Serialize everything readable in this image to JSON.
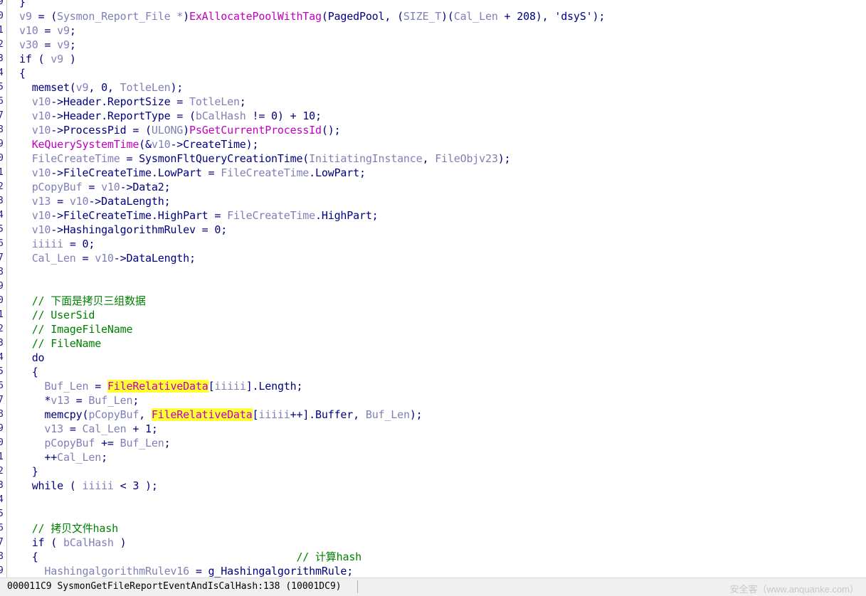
{
  "code_view": {
    "line_number_digits": [
      "9",
      "0",
      "1",
      "2",
      "3",
      "4",
      "5",
      "6",
      "7",
      "8",
      "9",
      "0",
      "1",
      "2",
      "3",
      "4",
      "5",
      "6",
      "7",
      "8",
      "9",
      "0",
      "1",
      "2",
      "3",
      "4",
      "5",
      "6",
      "7",
      "8",
      "9",
      "0",
      "1",
      "2",
      "3",
      "4",
      "5",
      "6",
      "7",
      "8",
      "9",
      "0"
    ],
    "lines": [
      [
        [
          "}",
          "kw"
        ]
      ],
      [
        [
          "v9",
          "var"
        ],
        [
          " = (",
          "kw"
        ],
        [
          "Sysmon_Report_File *",
          "var"
        ],
        [
          ")",
          "kw"
        ],
        [
          "ExAllocatePoolWithTag",
          "fn"
        ],
        [
          "(PagedPool, (",
          "kw"
        ],
        [
          "SIZE_T",
          "var"
        ],
        [
          ")(",
          "kw"
        ],
        [
          "Cal_Len",
          "var"
        ],
        [
          " + 208), 'dsyS');",
          "kw"
        ]
      ],
      [
        [
          "v10",
          "var"
        ],
        [
          " = ",
          "kw"
        ],
        [
          "v9",
          "var"
        ],
        [
          ";",
          "kw"
        ]
      ],
      [
        [
          "v30",
          "var"
        ],
        [
          " = ",
          "kw"
        ],
        [
          "v9",
          "var"
        ],
        [
          ";",
          "kw"
        ]
      ],
      [
        [
          "if ( ",
          "kw"
        ],
        [
          "v9",
          "var"
        ],
        [
          " )",
          "kw"
        ]
      ],
      [
        [
          "{",
          "kw"
        ]
      ],
      [
        [
          "  memset(",
          "kw"
        ],
        [
          "v9",
          "var"
        ],
        [
          ", 0, ",
          "kw"
        ],
        [
          "TotleLen",
          "var"
        ],
        [
          ");",
          "kw"
        ]
      ],
      [
        [
          "  ",
          "kw"
        ],
        [
          "v10",
          "var"
        ],
        [
          "->Header.ReportSize = ",
          "kw"
        ],
        [
          "TotleLen",
          "var"
        ],
        [
          ";",
          "kw"
        ]
      ],
      [
        [
          "  ",
          "kw"
        ],
        [
          "v10",
          "var"
        ],
        [
          "->Header.ReportType = (",
          "kw"
        ],
        [
          "bCalHash",
          "var"
        ],
        [
          " != 0) + 10;",
          "kw"
        ]
      ],
      [
        [
          "  ",
          "kw"
        ],
        [
          "v10",
          "var"
        ],
        [
          "->ProcessPid = (",
          "kw"
        ],
        [
          "ULONG",
          "var"
        ],
        [
          ")",
          "kw"
        ],
        [
          "PsGetCurrentProcessId",
          "fn"
        ],
        [
          "();",
          "kw"
        ]
      ],
      [
        [
          "  ",
          "kw"
        ],
        [
          "KeQuerySystemTime",
          "fn"
        ],
        [
          "(&",
          "kw"
        ],
        [
          "v10",
          "var"
        ],
        [
          "->CreateTime);",
          "kw"
        ]
      ],
      [
        [
          "  ",
          "kw"
        ],
        [
          "FileCreateTime",
          "var"
        ],
        [
          " = SysmonFltQueryCreationTime(",
          "kw"
        ],
        [
          "InitiatingInstance",
          "var"
        ],
        [
          ", ",
          "kw"
        ],
        [
          "FileObjv23",
          "var"
        ],
        [
          ");",
          "kw"
        ]
      ],
      [
        [
          "  ",
          "kw"
        ],
        [
          "v10",
          "var"
        ],
        [
          "->FileCreateTime.LowPart = ",
          "kw"
        ],
        [
          "FileCreateTime",
          "var"
        ],
        [
          ".LowPart;",
          "kw"
        ]
      ],
      [
        [
          "  ",
          "kw"
        ],
        [
          "pCopyBuf",
          "var"
        ],
        [
          " = ",
          "kw"
        ],
        [
          "v10",
          "var"
        ],
        [
          "->Data2;",
          "kw"
        ]
      ],
      [
        [
          "  ",
          "kw"
        ],
        [
          "v13",
          "var"
        ],
        [
          " = ",
          "kw"
        ],
        [
          "v10",
          "var"
        ],
        [
          "->DataLength;",
          "kw"
        ]
      ],
      [
        [
          "  ",
          "kw"
        ],
        [
          "v10",
          "var"
        ],
        [
          "->FileCreateTime.HighPart = ",
          "kw"
        ],
        [
          "FileCreateTime",
          "var"
        ],
        [
          ".HighPart;",
          "kw"
        ]
      ],
      [
        [
          "  ",
          "kw"
        ],
        [
          "v10",
          "var"
        ],
        [
          "->HashingalgorithmRulev = 0;",
          "kw"
        ]
      ],
      [
        [
          "  ",
          "kw"
        ],
        [
          "iiiii",
          "var"
        ],
        [
          " = 0;",
          "kw"
        ]
      ],
      [
        [
          "  ",
          "kw"
        ],
        [
          "Cal_Len",
          "var"
        ],
        [
          " = ",
          "kw"
        ],
        [
          "v10",
          "var"
        ],
        [
          "->DataLength;",
          "kw"
        ]
      ],
      [],
      [],
      [
        [
          "  // 下面是拷贝三组数据",
          "cm"
        ]
      ],
      [
        [
          "  // UserSid",
          "cm"
        ]
      ],
      [
        [
          "  // ImageFileName",
          "cm"
        ]
      ],
      [
        [
          "  // FileName",
          "cm"
        ]
      ],
      [
        [
          "  do",
          "kw"
        ]
      ],
      [
        [
          "  {",
          "kw"
        ]
      ],
      [
        [
          "    ",
          "kw"
        ],
        [
          "Buf_Len",
          "var"
        ],
        [
          " = ",
          "kw"
        ],
        [
          "FileRelativeData",
          "fn hl"
        ],
        [
          "[",
          "kw"
        ],
        [
          "iiiii",
          "var"
        ],
        [
          "].Length;",
          "kw"
        ]
      ],
      [
        [
          "    *",
          "kw"
        ],
        [
          "v13",
          "var"
        ],
        [
          " = ",
          "kw"
        ],
        [
          "Buf_Len",
          "var"
        ],
        [
          ";",
          "kw"
        ]
      ],
      [
        [
          "    memcpy(",
          "kw"
        ],
        [
          "pCopyBuf",
          "var"
        ],
        [
          ", ",
          "kw"
        ],
        [
          "|",
          "cursor"
        ],
        [
          "FileRelativeData",
          "fn hl"
        ],
        [
          "[",
          "kw"
        ],
        [
          "iiiii",
          "var"
        ],
        [
          "++].Buffer, ",
          "kw"
        ],
        [
          "Buf_Len",
          "var"
        ],
        [
          ");",
          "kw"
        ]
      ],
      [
        [
          "    ",
          "kw"
        ],
        [
          "v13",
          "var"
        ],
        [
          " = ",
          "kw"
        ],
        [
          "Cal_Len",
          "var"
        ],
        [
          " + 1;",
          "kw"
        ]
      ],
      [
        [
          "    ",
          "kw"
        ],
        [
          "pCopyBuf",
          "var"
        ],
        [
          " += ",
          "kw"
        ],
        [
          "Buf_Len",
          "var"
        ],
        [
          ";",
          "kw"
        ]
      ],
      [
        [
          "    ++",
          "kw"
        ],
        [
          "Cal_Len",
          "var"
        ],
        [
          ";",
          "kw"
        ]
      ],
      [
        [
          "  }",
          "kw"
        ]
      ],
      [
        [
          "  while ( ",
          "kw"
        ],
        [
          "iiiii",
          "var"
        ],
        [
          " < 3 );",
          "kw"
        ]
      ],
      [],
      [],
      [
        [
          "  // 拷贝文件hash",
          "cm"
        ]
      ],
      [
        [
          "  if ( ",
          "kw"
        ],
        [
          "bCalHash",
          "var"
        ],
        [
          " )",
          "kw"
        ]
      ],
      [
        [
          "  {                                         ",
          "kw"
        ],
        [
          "// 计算hash",
          "cm"
        ]
      ],
      [
        [
          "    ",
          "kw"
        ],
        [
          "HashingalgorithmRulev16",
          "var"
        ],
        [
          " = g_HashingalgorithmRule;",
          "kw"
        ]
      ]
    ]
  },
  "status_bar": {
    "location": "000011C9 SysmonGetFileReportEventAndIsCalHash:138 (10001DC9)",
    "watermark": "安全客（www.anquanke.com）"
  }
}
